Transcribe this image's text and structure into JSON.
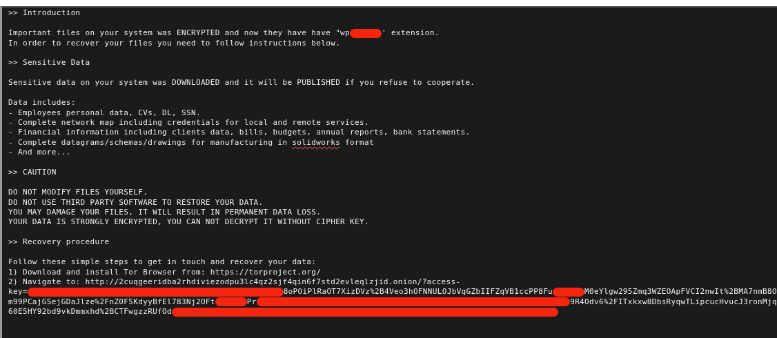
{
  "document": {
    "lines": [
      {
        "kind": "heading",
        "segments": [
          {
            "kind": "text",
            "text": ">> Introduction"
          }
        ]
      },
      {
        "kind": "blank"
      },
      {
        "kind": "text",
        "segments": [
          {
            "kind": "text",
            "text": "Important files on your system was ENCRYPTED and now they have have \"wp"
          },
          {
            "kind": "redaction-dot"
          },
          {
            "kind": "text",
            "text": "' extension."
          }
        ]
      },
      {
        "kind": "text",
        "segments": [
          {
            "kind": "text",
            "text": "In order to recover your files you need to follow instructions below."
          }
        ]
      },
      {
        "kind": "blank"
      },
      {
        "kind": "heading",
        "segments": [
          {
            "kind": "text",
            "text": ">> Sensitive Data"
          }
        ]
      },
      {
        "kind": "blank"
      },
      {
        "kind": "text",
        "segments": [
          {
            "kind": "text",
            "text": "Sensitive data on your system was DOWNLOADED and it will be PUBLISHED if you refuse to cooperate."
          }
        ]
      },
      {
        "kind": "blank"
      },
      {
        "kind": "text",
        "segments": [
          {
            "kind": "text",
            "text": "Data includes:"
          }
        ]
      },
      {
        "kind": "text",
        "segments": [
          {
            "kind": "text",
            "text": "- Employees personal data, CVs, DL, SSN."
          }
        ]
      },
      {
        "kind": "text",
        "segments": [
          {
            "kind": "text",
            "text": "- Complete network map including credentials for local and remote services."
          }
        ]
      },
      {
        "kind": "text",
        "segments": [
          {
            "kind": "text",
            "text": "- Financial information including clients data, bills, budgets, annual reports, bank statements."
          }
        ]
      },
      {
        "kind": "text",
        "segments": [
          {
            "kind": "text",
            "text": "- Complete datagrams/schemas/drawings for manufacturing in "
          },
          {
            "kind": "text",
            "text": "solidworks",
            "misspelled": true
          },
          {
            "kind": "text",
            "text": " format"
          }
        ]
      },
      {
        "kind": "text",
        "segments": [
          {
            "kind": "text",
            "text": "- And more..."
          }
        ]
      },
      {
        "kind": "blank"
      },
      {
        "kind": "heading",
        "segments": [
          {
            "kind": "text",
            "text": ">> CAUTION"
          }
        ]
      },
      {
        "kind": "blank"
      },
      {
        "kind": "text",
        "segments": [
          {
            "kind": "text",
            "text": "DO NOT MODIFY FILES YOURSELF."
          }
        ]
      },
      {
        "kind": "text",
        "segments": [
          {
            "kind": "text",
            "text": "DO NOT USE THIRD PARTY SOFTWARE TO RESTORE YOUR DATA."
          }
        ]
      },
      {
        "kind": "text",
        "segments": [
          {
            "kind": "text",
            "text": "YOU MAY DAMAGE YOUR FILES, IT WILL RESULT IN PERMANENT DATA LOSS."
          }
        ]
      },
      {
        "kind": "text",
        "segments": [
          {
            "kind": "text",
            "text": "YOUR DATA IS STRONGLY ENCRYPTED, YOU CAN NOT DECRYPT IT WITHOUT CIPHER KEY."
          }
        ]
      },
      {
        "kind": "blank"
      },
      {
        "kind": "heading",
        "segments": [
          {
            "kind": "text",
            "text": ">> Recovery procedure"
          }
        ]
      },
      {
        "kind": "blank"
      },
      {
        "kind": "text",
        "segments": [
          {
            "kind": "text",
            "text": "Follow these simple steps to get in touch and recover your data:"
          }
        ]
      },
      {
        "kind": "text",
        "segments": [
          {
            "kind": "text",
            "text": "1) Download and install Tor Browser from: https://torproject.org/"
          }
        ]
      },
      {
        "kind": "text",
        "segments": [
          {
            "kind": "text",
            "text": "2) Navigate to: http://2cuqgeeridba2rhdiviezodpu3lc4qz2sjf4qin6f7std2evleqlzjid.onion/?access-"
          }
        ]
      },
      {
        "kind": "text",
        "segments": [
          {
            "kind": "text",
            "text": "key="
          },
          {
            "kind": "redaction-streak"
          },
          {
            "kind": "text",
            "text": "8oPOiPlRaOT7XizDVz%2B4Veo3hOFNNULOJbVqGZbIIFZqVB1ccPP8Fu"
          },
          {
            "kind": "redaction-dot"
          },
          {
            "kind": "text",
            "text": "M0eYlgw295Zmq3WZEOApFVCI2nwIt%2BMA7nmB8O"
          }
        ]
      },
      {
        "kind": "text",
        "segments": [
          {
            "kind": "text",
            "text": "m99PCajGSejGDaJlze%2FnZ0F5KdyyBfEl783Nj2OFt"
          },
          {
            "kind": "redaction-dot"
          },
          {
            "kind": "text",
            "text": "Pr"
          },
          {
            "kind": "redaction-streak"
          },
          {
            "kind": "text",
            "text": "9R4Odv6%2FITxkxw8DbsRyqwTLipcucHvucJ3ronMjq"
          }
        ]
      },
      {
        "kind": "text",
        "segments": [
          {
            "kind": "text",
            "text": "60E5HY92bd9vkDmmxhd%2BCTFwgzzRUfOd"
          },
          {
            "kind": "redaction-streak"
          }
        ]
      }
    ]
  }
}
